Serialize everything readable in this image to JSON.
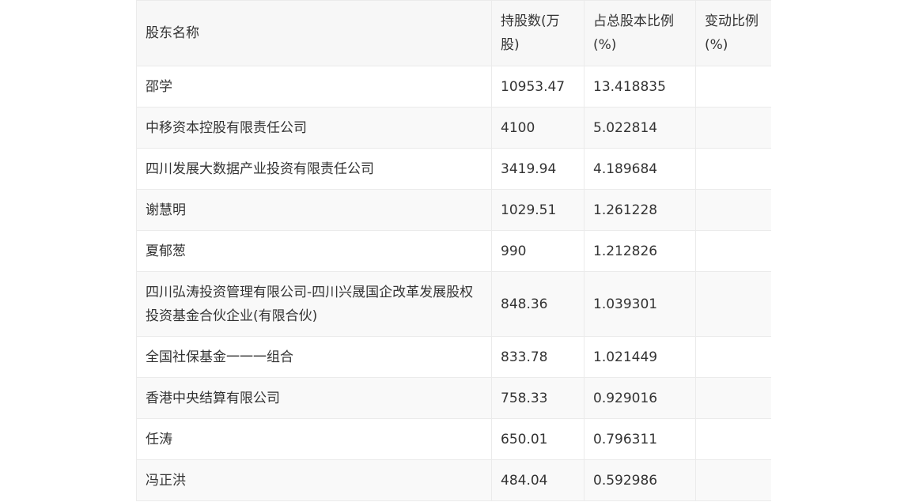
{
  "table": {
    "headers": [
      "股东名称",
      "持股数(万股)",
      "占总股本比例(%)",
      "变动比例(%)"
    ],
    "rows": [
      [
        "邵学",
        "10953.47",
        "13.418835",
        ""
      ],
      [
        "中移资本控股有限责任公司",
        "4100",
        "5.022814",
        ""
      ],
      [
        "四川发展大数据产业投资有限责任公司",
        "3419.94",
        "4.189684",
        ""
      ],
      [
        "谢慧明",
        "1029.51",
        "1.261228",
        ""
      ],
      [
        "夏郁葱",
        "990",
        "1.212826",
        ""
      ],
      [
        "四川弘涛投资管理有限公司-四川兴晟国企改革发展股权投资基金合伙企业(有限合伙)",
        "848.36",
        "1.039301",
        ""
      ],
      [
        "全国社保基金一一一组合",
        "833.78",
        "1.021449",
        ""
      ],
      [
        "香港中央结算有限公司",
        "758.33",
        "0.929016",
        ""
      ],
      [
        "任涛",
        "650.01",
        "0.796311",
        ""
      ],
      [
        "冯正洪",
        "484.04",
        "0.592986",
        ""
      ]
    ]
  }
}
